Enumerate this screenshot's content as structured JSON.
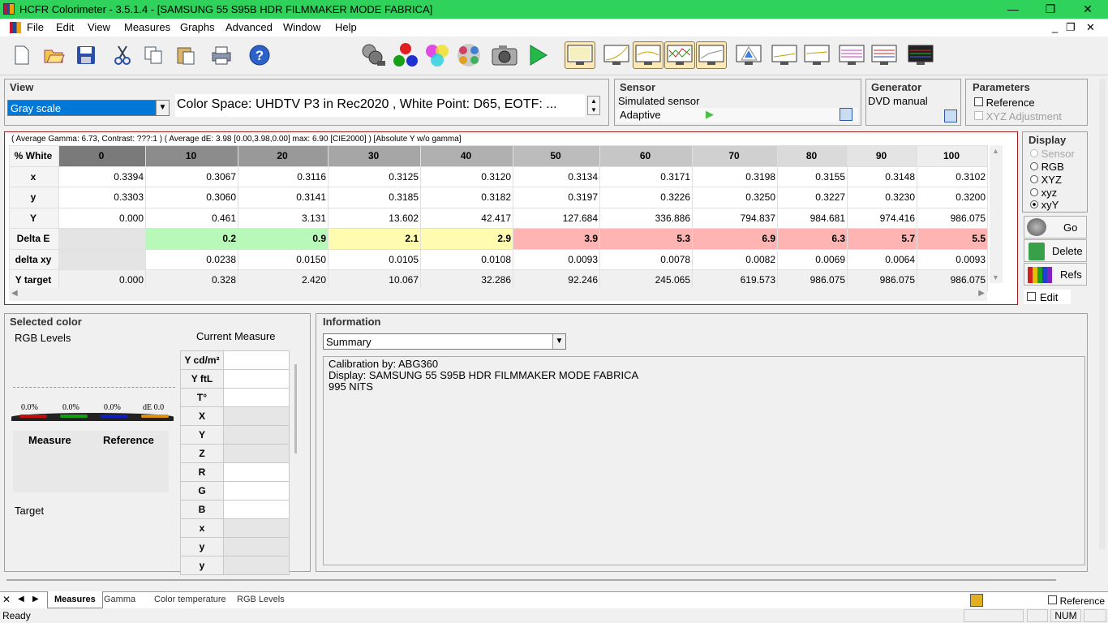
{
  "window": {
    "title": "HCFR Colorimeter - 3.5.1.4 - [SAMSUNG 55 S95B HDR FILMMAKER MODE FABRICA]",
    "minimize": "—",
    "restore": "❐",
    "close": "✕"
  },
  "menu": [
    "File",
    "Edit",
    "View",
    "Measures",
    "Graphs",
    "Advanced",
    "Window",
    "Help"
  ],
  "mdi": {
    "minimize": "_",
    "restore": "❐",
    "close": "✕"
  },
  "view": {
    "title": "View",
    "selected": "Gray scale",
    "colorspace": "Color Space: UHDTV P3 in Rec2020 , White Point: D65, EOTF:  ..."
  },
  "sensor": {
    "title": "Sensor",
    "name": "Simulated sensor",
    "mode": "Adaptive"
  },
  "generator": {
    "title": "Generator",
    "name": "DVD manual"
  },
  "parameters": {
    "title": "Parameters",
    "reference": "Reference",
    "xyz": "XYZ Adjustment"
  },
  "summary": "( Average Gamma: 6.73, Contrast: ???:1 ) ( Average dE: 3.98 [0.00,3.98,0.00] max: 6.90 [CIE2000] ) [Absolute Y w/o gamma]",
  "table": {
    "header": [
      "% White",
      "0",
      "10",
      "20",
      "30",
      "40",
      "50",
      "60",
      "70",
      "80",
      "90",
      "100"
    ],
    "rows": [
      {
        "label": "x",
        "values": [
          "0.3394",
          "0.3067",
          "0.3116",
          "0.3125",
          "0.3120",
          "0.3134",
          "0.3171",
          "0.3198",
          "0.3155",
          "0.3148",
          "0.3102"
        ]
      },
      {
        "label": "y",
        "values": [
          "0.3303",
          "0.3060",
          "0.3141",
          "0.3185",
          "0.3182",
          "0.3197",
          "0.3226",
          "0.3250",
          "0.3227",
          "0.3230",
          "0.3200"
        ]
      },
      {
        "label": "Y",
        "values": [
          "0.000",
          "0.461",
          "3.131",
          "13.602",
          "42.417",
          "127.684",
          "336.886",
          "794.837",
          "984.681",
          "974.416",
          "986.075"
        ]
      },
      {
        "label": "Delta E",
        "values": [
          "",
          "0.2",
          "0.9",
          "2.1",
          "2.9",
          "3.9",
          "5.3",
          "6.9",
          "6.3",
          "5.7",
          "5.5"
        ]
      },
      {
        "label": "delta xy",
        "values": [
          "",
          "0.0238",
          "0.0150",
          "0.0105",
          "0.0108",
          "0.0093",
          "0.0078",
          "0.0082",
          "0.0069",
          "0.0064",
          "0.0093"
        ]
      },
      {
        "label": "Y target",
        "values": [
          "0.000",
          "0.328",
          "2.420",
          "10.067",
          "32.286",
          "92.246",
          "245.065",
          "619.573",
          "986.075",
          "986.075",
          "986.075"
        ]
      }
    ]
  },
  "colors": {
    "de_good": "#b8f8b8",
    "de_mid": "#fffcb0",
    "de_bad": "#ffb4b4",
    "header_dark": "#7a7a7a",
    "title_green": "#2fd25a"
  },
  "display": {
    "title": "Display",
    "options": [
      "Sensor",
      "RGB",
      "XYZ",
      "xyz",
      "xyY"
    ],
    "selected": "xyY",
    "go": "Go",
    "delete": "Delete",
    "refs": "Refs",
    "edit": "Edit"
  },
  "selected": {
    "title": "Selected color",
    "rgb_levels": "RGB Levels",
    "current": "Current Measure",
    "pct": [
      "0.0%",
      "0.0%",
      "0.0%",
      "dE 0.0"
    ],
    "measure": "Measure",
    "reference": "Reference",
    "target": "Target",
    "rows": [
      "Y cd/m²",
      "Y ftL",
      "T°",
      "X",
      "Y",
      "Z",
      "R",
      "G",
      "B",
      "x",
      "y",
      "y"
    ]
  },
  "info": {
    "title": "Information",
    "selected": "Summary",
    "lines": [
      "Calibration by: ABG360",
      "Display: SAMSUNG 55 S95B HDR FILMMAKER MODE FABRICA",
      "995 NITS"
    ]
  },
  "tabs": [
    "Measures",
    "Gamma",
    "Color temperature",
    "RGB Levels"
  ],
  "status": {
    "text": "Ready",
    "num": "NUM",
    "reference": "Reference"
  }
}
